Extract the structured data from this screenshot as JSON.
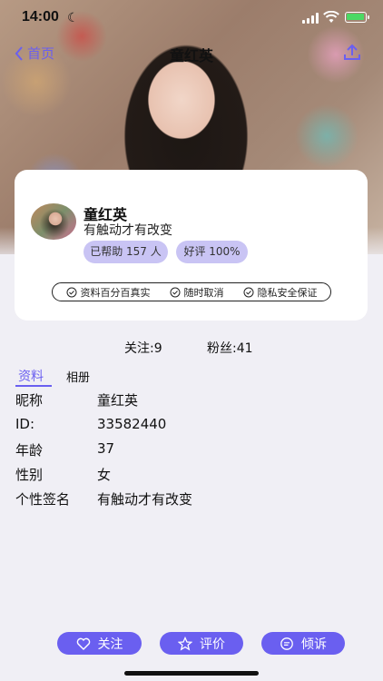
{
  "status_bar": {
    "time": "14:00"
  },
  "nav": {
    "back_label": "首页",
    "title": "童红英"
  },
  "profile": {
    "name": "童红英",
    "signature": "有触动才有改变",
    "helped_badge": "已帮助 157 人",
    "rating_badge": "好评 100%",
    "guarantees": [
      "资料百分百真实",
      "随时取消",
      "隐私安全保证"
    ]
  },
  "stats": {
    "following": "关注:9",
    "fans": "粉丝:41"
  },
  "tabs": {
    "info": "资料",
    "album": "相册"
  },
  "info_rows": [
    {
      "label": "昵称",
      "value": "童红英"
    },
    {
      "label": "ID:",
      "value": "33582440"
    },
    {
      "label": "年龄",
      "value": "37"
    },
    {
      "label": "性别",
      "value": "女"
    },
    {
      "label": "个性签名",
      "value": "有触动才有改变"
    }
  ],
  "actions": {
    "follow": "关注",
    "review": "评价",
    "confide": "倾诉"
  },
  "colors": {
    "accent": "#6a5ff0",
    "chip": "#c9c4f4",
    "background": "#f0eff5"
  }
}
